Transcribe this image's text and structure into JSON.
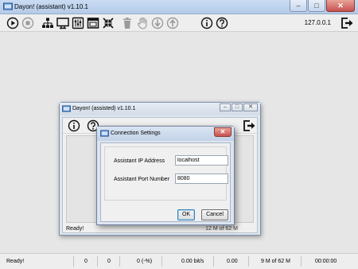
{
  "main_window": {
    "title": "Dayon! (assistant) v1.10.1",
    "controls": {
      "minimize": "–",
      "maximize": "□",
      "close": "✕"
    }
  },
  "toolbar": {
    "ip": "127.0.0.1",
    "icons": [
      "play-icon",
      "stop-icon",
      "network-icon",
      "monitor-icon",
      "settings-icon",
      "window-icon",
      "fullscreen-icon",
      "trash-icon",
      "hand-icon",
      "download-icon",
      "upload-icon",
      "info-icon",
      "help-icon",
      "exit-icon"
    ]
  },
  "statusbar": {
    "status": "Ready!",
    "v1": "0",
    "v2": "0",
    "v3": "0 (-%)",
    "rate": "0.00 bit/s",
    "v4": "0.00",
    "memory": "9 M of 62 M",
    "time": "00:00:00"
  },
  "assisted_window": {
    "title": "Dayon! (assisted) v1.10.1",
    "status": "Ready!",
    "memory": "12 M of 62 M",
    "controls": {
      "minimize": "–",
      "maximize": "□",
      "close": "✕"
    }
  },
  "dialog": {
    "title": "Connection Settings",
    "close": "✕",
    "ip_label": "Assistant IP Address",
    "ip_value": "localhost",
    "port_label": "Assistant Port Number",
    "port_value": "8080",
    "ok": "OK",
    "cancel": "Cancel"
  },
  "colors": {
    "titlebar": "#c9dcf2",
    "close": "#c75050",
    "background": "#e6e6e6"
  }
}
